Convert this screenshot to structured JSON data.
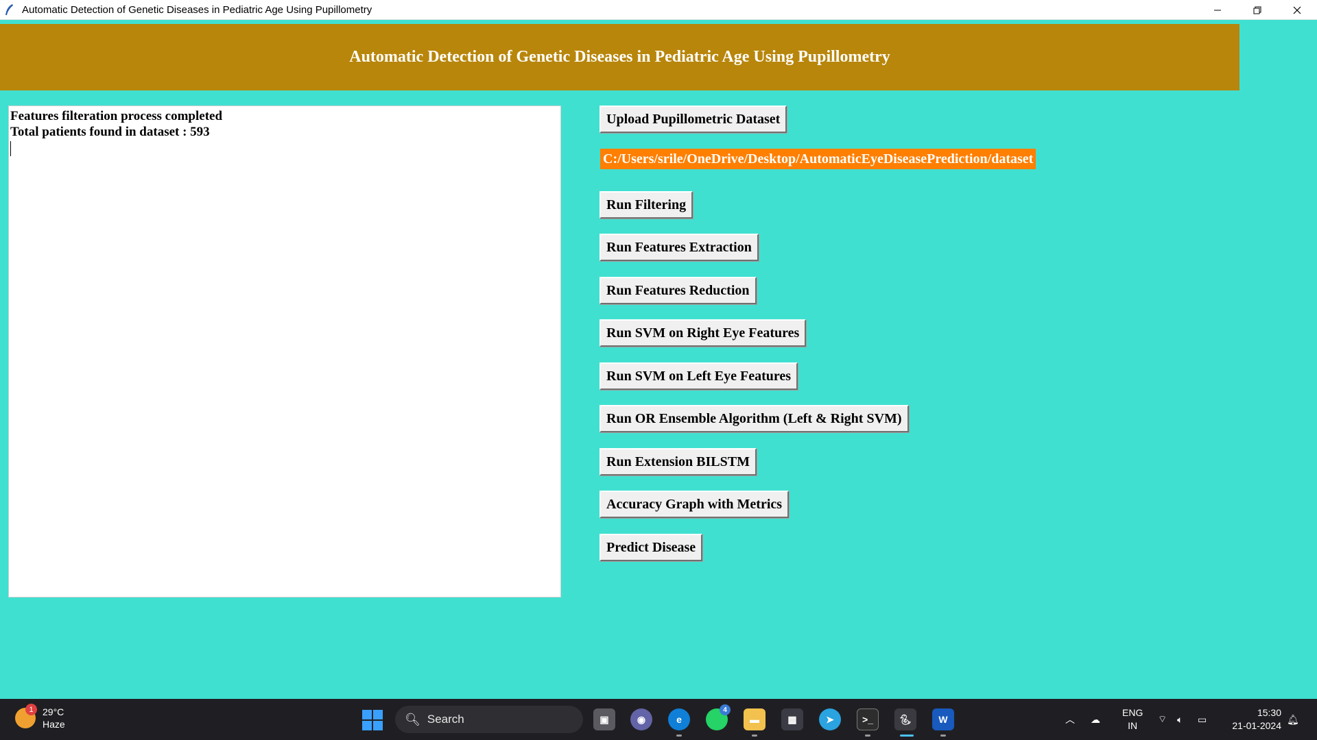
{
  "window": {
    "title": "Automatic Detection of Genetic Diseases in Pediatric Age Using Pupillometry"
  },
  "heading": "Automatic Detection of Genetic Diseases in Pediatric Age Using Pupillometry",
  "output": {
    "lines": [
      "Features filteration process completed",
      "Total patients found in dataset : 593"
    ]
  },
  "buttons": {
    "upload": "Upload Pupillometric Dataset",
    "filtering": "Run Filtering",
    "extraction": "Run Features Extraction",
    "reduction": "Run Features Reduction",
    "svm_right": "Run SVM on Right Eye Features",
    "svm_left": "Run SVM on Left Eye Features",
    "ensemble": "Run OR Ensemble Algorithm (Left & Right SVM)",
    "bilstm": "Run Extension BILSTM",
    "graph": "Accuracy Graph with Metrics",
    "predict": "Predict Disease"
  },
  "dataset_path": "C:/Users/srile/OneDrive/Desktop/AutomaticEyeDiseasePrediction/dataset",
  "colors": {
    "background": "#40e0d0",
    "heading": "#b8860b",
    "path_label": "#ff7f00"
  },
  "taskbar": {
    "weather_temp": "29°C",
    "weather_desc": "Haze",
    "weather_badge": "1",
    "search_label": "Search",
    "whatsapp_badge": "4",
    "lang_top": "ENG",
    "lang_bottom": "IN",
    "time": "15:30",
    "date": "21-01-2024"
  }
}
